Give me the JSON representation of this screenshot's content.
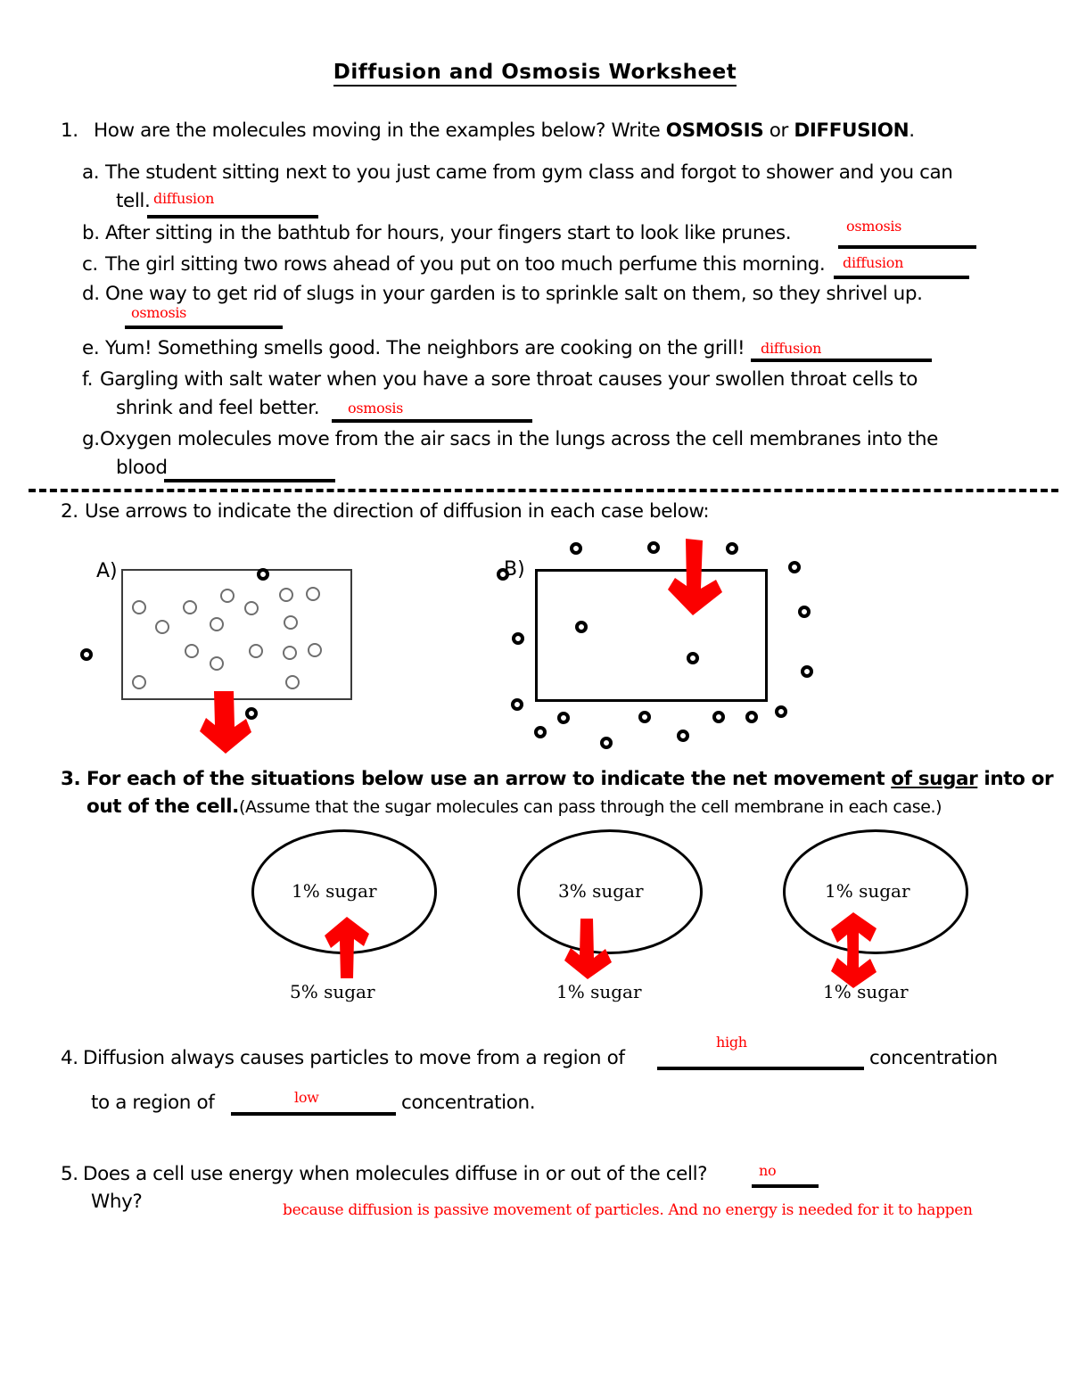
{
  "document": {
    "title": "Diffusion and Osmosis Worksheet",
    "answer_color": "#ff0000",
    "ink_color": "#000000"
  },
  "q1": {
    "number": "1.",
    "prompt_pre": "How are the molecules moving in the examples below? Write ",
    "prompt_bold1": "OSMOSIS",
    "prompt_mid": " or ",
    "prompt_bold2": "DIFFUSION",
    "prompt_end": ".",
    "items": [
      {
        "letter": "a.",
        "line1": "The student sitting next to you just came from gym class and forgot to shower and you can",
        "line2": "tell.",
        "answer": "diffusion"
      },
      {
        "letter": "b.",
        "line1": "After sitting in the bathtub for hours, your fingers start to look like prunes.",
        "answer": "osmosis"
      },
      {
        "letter": "c.",
        "line1": "The girl sitting two rows ahead of you put on too much perfume this morning.",
        "answer": "diffusion"
      },
      {
        "letter": "d.",
        "line1": "One way to get rid of slugs in your garden is to sprinkle salt on them, so they shrivel up.",
        "answer": "osmosis"
      },
      {
        "letter": "e.",
        "line1": "Yum! Something smells good. The neighbors are cooking on the grill!",
        "answer": "diffusion"
      },
      {
        "letter": "f.",
        "line1": "Gargling with salt water when you have a sore throat causes your swollen throat cells to",
        "line2": "shrink and feel better.",
        "answer": "osmosis"
      },
      {
        "letter": "g.",
        "line1": "Oxygen molecules move from the air sacs in the lungs across the cell membranes into the",
        "line2": "blood",
        "answer": ""
      }
    ]
  },
  "q2": {
    "number": "2.",
    "prompt": "Use arrows to indicate the direction of diffusion in each case below:",
    "diagrams": [
      {
        "label": "A)",
        "inside_count": 17,
        "outside_count": 3,
        "arrow_direction": "down-out"
      },
      {
        "label": "B)",
        "inside_count": 2,
        "outside_count": 19,
        "arrow_direction": "down-in"
      }
    ]
  },
  "q3": {
    "number": "3.",
    "prompt_line1_pre": "For each of the situations below use an arrow to indicate the net movement ",
    "prompt_line1_bold_ul": "of sugar",
    "prompt_line1_post": " into or",
    "prompt_line2_bold": "out of the cell.",
    "prompt_line2_note": "(Assume that the sugar molecules can pass through the cell membrane in each case.)",
    "cells": [
      {
        "inside": "1% sugar",
        "outside": "5% sugar",
        "arrow": "up"
      },
      {
        "inside": "3% sugar",
        "outside": "1% sugar",
        "arrow": "down"
      },
      {
        "inside": "1% sugar",
        "outside": "1% sugar",
        "arrow": "both"
      }
    ]
  },
  "q4": {
    "number": "4.",
    "line1_pre": "Diffusion always causes particles to move from a region of ",
    "line1_post": " concentration",
    "line2_pre": "to a region of ",
    "line2_post": " concentration.",
    "answer1": "high",
    "answer2": "low"
  },
  "q5": {
    "number": "5.",
    "prompt": "Does a cell use energy when molecules diffuse in or out of the cell?",
    "answer_short": "no",
    "why_label": "Why?",
    "answer_long": "because diffusion is passive movement of particles. And no energy is needed for it to happen"
  }
}
